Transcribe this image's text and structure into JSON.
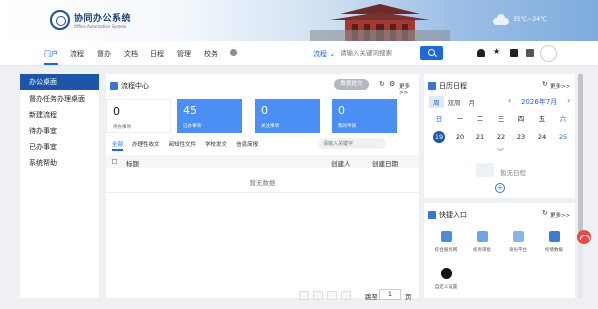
{
  "header": {
    "logo_title": "协同办公系统",
    "logo_subtitle": "Office Automation System",
    "weather_temp": "35℃~24℃"
  },
  "nav": {
    "items": [
      "门户",
      "流程",
      "督办",
      "文档",
      "日程",
      "管理",
      "校务"
    ],
    "search_type": "流程",
    "search_placeholder": "请输入关键词搜索"
  },
  "sidebar": {
    "items": [
      "办公桌面",
      "督办任务办理桌面",
      "新建流程",
      "待办事宜",
      "已办事宜",
      "系统帮助"
    ]
  },
  "process_center": {
    "title": "流程中心",
    "data_submit_label": "数据提交",
    "more_label": "更多>>",
    "stats": [
      {
        "value": "0",
        "label": "待办事项"
      },
      {
        "value": "45",
        "label": "已办事项"
      },
      {
        "value": "0",
        "label": "关注事项"
      },
      {
        "value": "0",
        "label": "我的申请"
      }
    ],
    "tabs": [
      "全部",
      "办理性收文",
      "阅知性文件",
      "学校发文",
      "信息简报"
    ],
    "search_placeholder": "请输入关键字",
    "columns": [
      "标题",
      "创建人",
      "创建日期"
    ],
    "empty_text": "暂无数据",
    "pager": {
      "goto_label": "跳至",
      "page_value": "1",
      "page_suffix": "页"
    }
  },
  "calendar": {
    "title": "日历日程",
    "more_label": "更多>>",
    "tabs": [
      "周",
      "双周",
      "月"
    ],
    "month": "2026年7月",
    "weekdays": [
      "日",
      "一",
      "二",
      "三",
      "四",
      "五",
      "六"
    ],
    "days": [
      "19",
      "20",
      "21",
      "22",
      "23",
      "24",
      "25"
    ],
    "no_schedule": "暂无日程"
  },
  "quick_entry": {
    "title": "快捷入口",
    "more_label": "更多>>",
    "items": [
      "综合服务网",
      "校务审批",
      "身份平台",
      "校情数据",
      "自定义设置"
    ]
  },
  "colors": {
    "primary": "#1d56a6",
    "accent": "#1e6ad4",
    "stat_blue": "#4b8ff5",
    "float_red": "#e84a4a"
  }
}
